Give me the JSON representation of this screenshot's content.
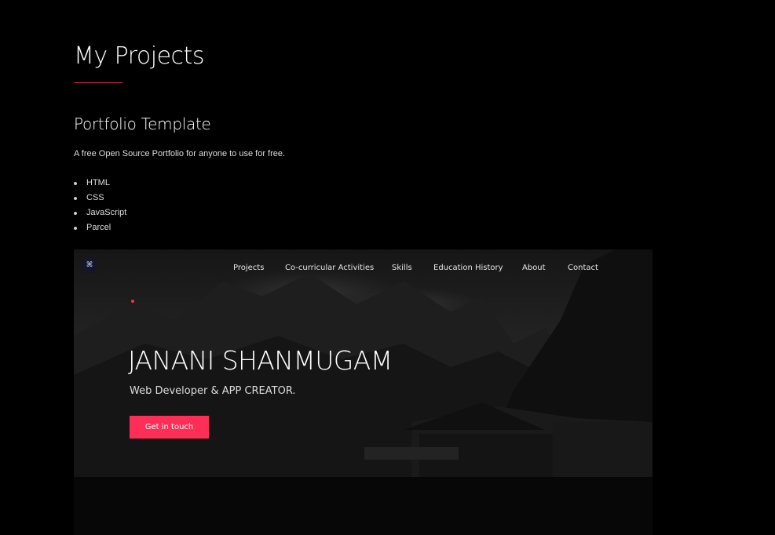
{
  "section": {
    "heading": "My Projects",
    "accent_color": "#e2294f"
  },
  "project": {
    "title": "Portfolio Template",
    "description": "A free Open Source Portfolio for anyone to use for free.",
    "technologies": [
      "HTML",
      "CSS",
      "JavaScript",
      "Parcel"
    ]
  },
  "preview": {
    "logo_icon": "⌘",
    "nav": [
      "Projects",
      "Co-curricular Activities",
      "Skills",
      "Education History",
      "About",
      "Contact"
    ],
    "hero_name": "JANANI SHANMUGAM",
    "hero_subtitle": "Web Developer & APP CREATOR.",
    "cta_label": "Get in touch",
    "cta_color": "#ff2e56"
  }
}
